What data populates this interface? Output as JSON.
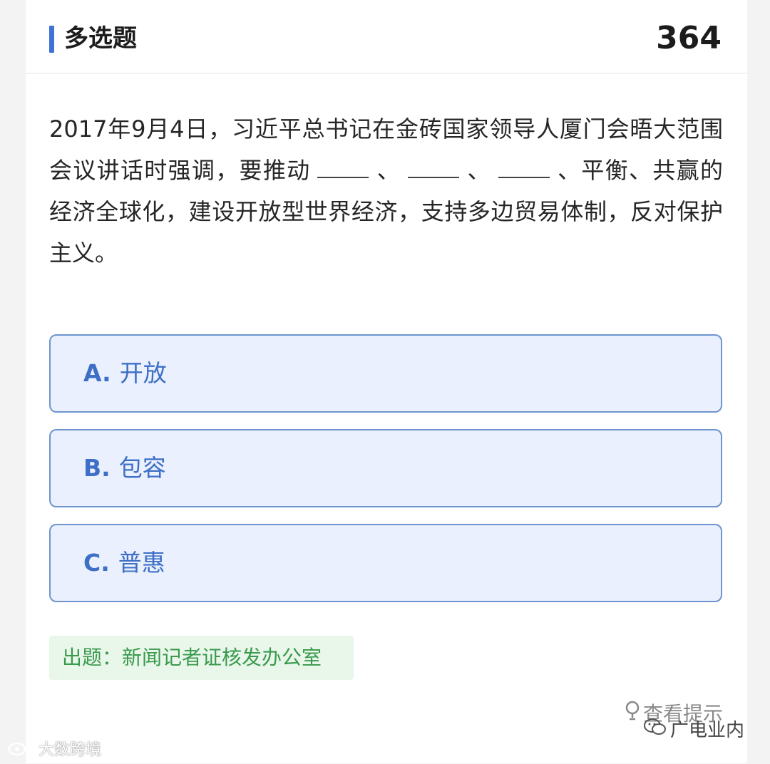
{
  "header": {
    "question_type": "多选题",
    "question_number": "364"
  },
  "question": {
    "part1": "2017年9月4日，习近平总书记在金砖国家领导人厦门会晤大范围会议讲话时强调，要推动",
    "sep1": "、",
    "sep2": "、",
    "part2": "、平衡、共赢的经济全球化，建设开放型世界经济，支持多边贸易体制，反对保护主义。"
  },
  "options": [
    {
      "letter": "A.",
      "text": "开放"
    },
    {
      "letter": "B.",
      "text": "包容"
    },
    {
      "letter": "C.",
      "text": "普惠"
    }
  ],
  "source": "出题：新闻记者证核发办公室",
  "hint_label": "查看提示",
  "watermark_left": "大数跨境",
  "watermark_right": "广电业内",
  "colors": {
    "accent": "#3f72d4",
    "option_bg": "#eaf0fd",
    "option_border": "#6e95cf",
    "option_text": "#3d6fc6",
    "source_bg": "#e9f6ea",
    "source_text": "#3a9a4d"
  },
  "icons": {
    "hint": "lightbulb-icon",
    "watermark_left": "weibo-icon",
    "watermark_right": "wechat-icon"
  }
}
